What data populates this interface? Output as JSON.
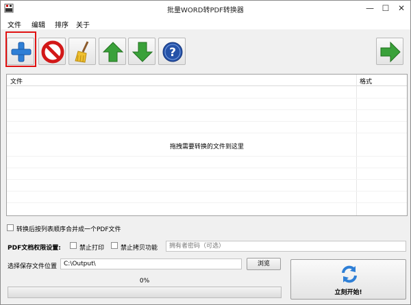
{
  "window": {
    "title": "批量WORD转PDF转换器",
    "controls": {
      "minimize": "—",
      "maximize": "☐",
      "close": "✕"
    }
  },
  "menu": [
    "文件",
    "编辑",
    "排序",
    "关于"
  ],
  "toolbar": {
    "buttons": [
      "add-icon",
      "remove-icon",
      "clear-broom-icon",
      "move-up-icon",
      "move-down-icon",
      "help-icon"
    ],
    "right_button": "next-arrow-icon",
    "highlighted": "add-icon",
    "colors": {
      "highlight": "#e01010",
      "add": "#2e7fd6",
      "remove": "#d21818",
      "arrows": "#3aa13a",
      "help": "#2552a8"
    }
  },
  "filelist": {
    "columns": [
      "文件",
      "格式"
    ],
    "drop_hint": "拖拽需要转换的文件到这里"
  },
  "options": {
    "merge_label": "转换后按列表顺序合并成一个PDF文件",
    "merge_checked": false,
    "permission_title": "PDF文档权限设置:",
    "no_print_label": "禁止打印",
    "no_print_checked": false,
    "no_copy_label": "禁止拷贝功能",
    "no_copy_checked": false,
    "password_placeholder": "拥有者密码（可选）"
  },
  "output": {
    "label": "选择保存文件位置",
    "path": "C:\\Output\\",
    "browse_label": "浏览"
  },
  "progress": {
    "percent_text": "0%",
    "value": 0
  },
  "start": {
    "label": "立刻开始!"
  }
}
